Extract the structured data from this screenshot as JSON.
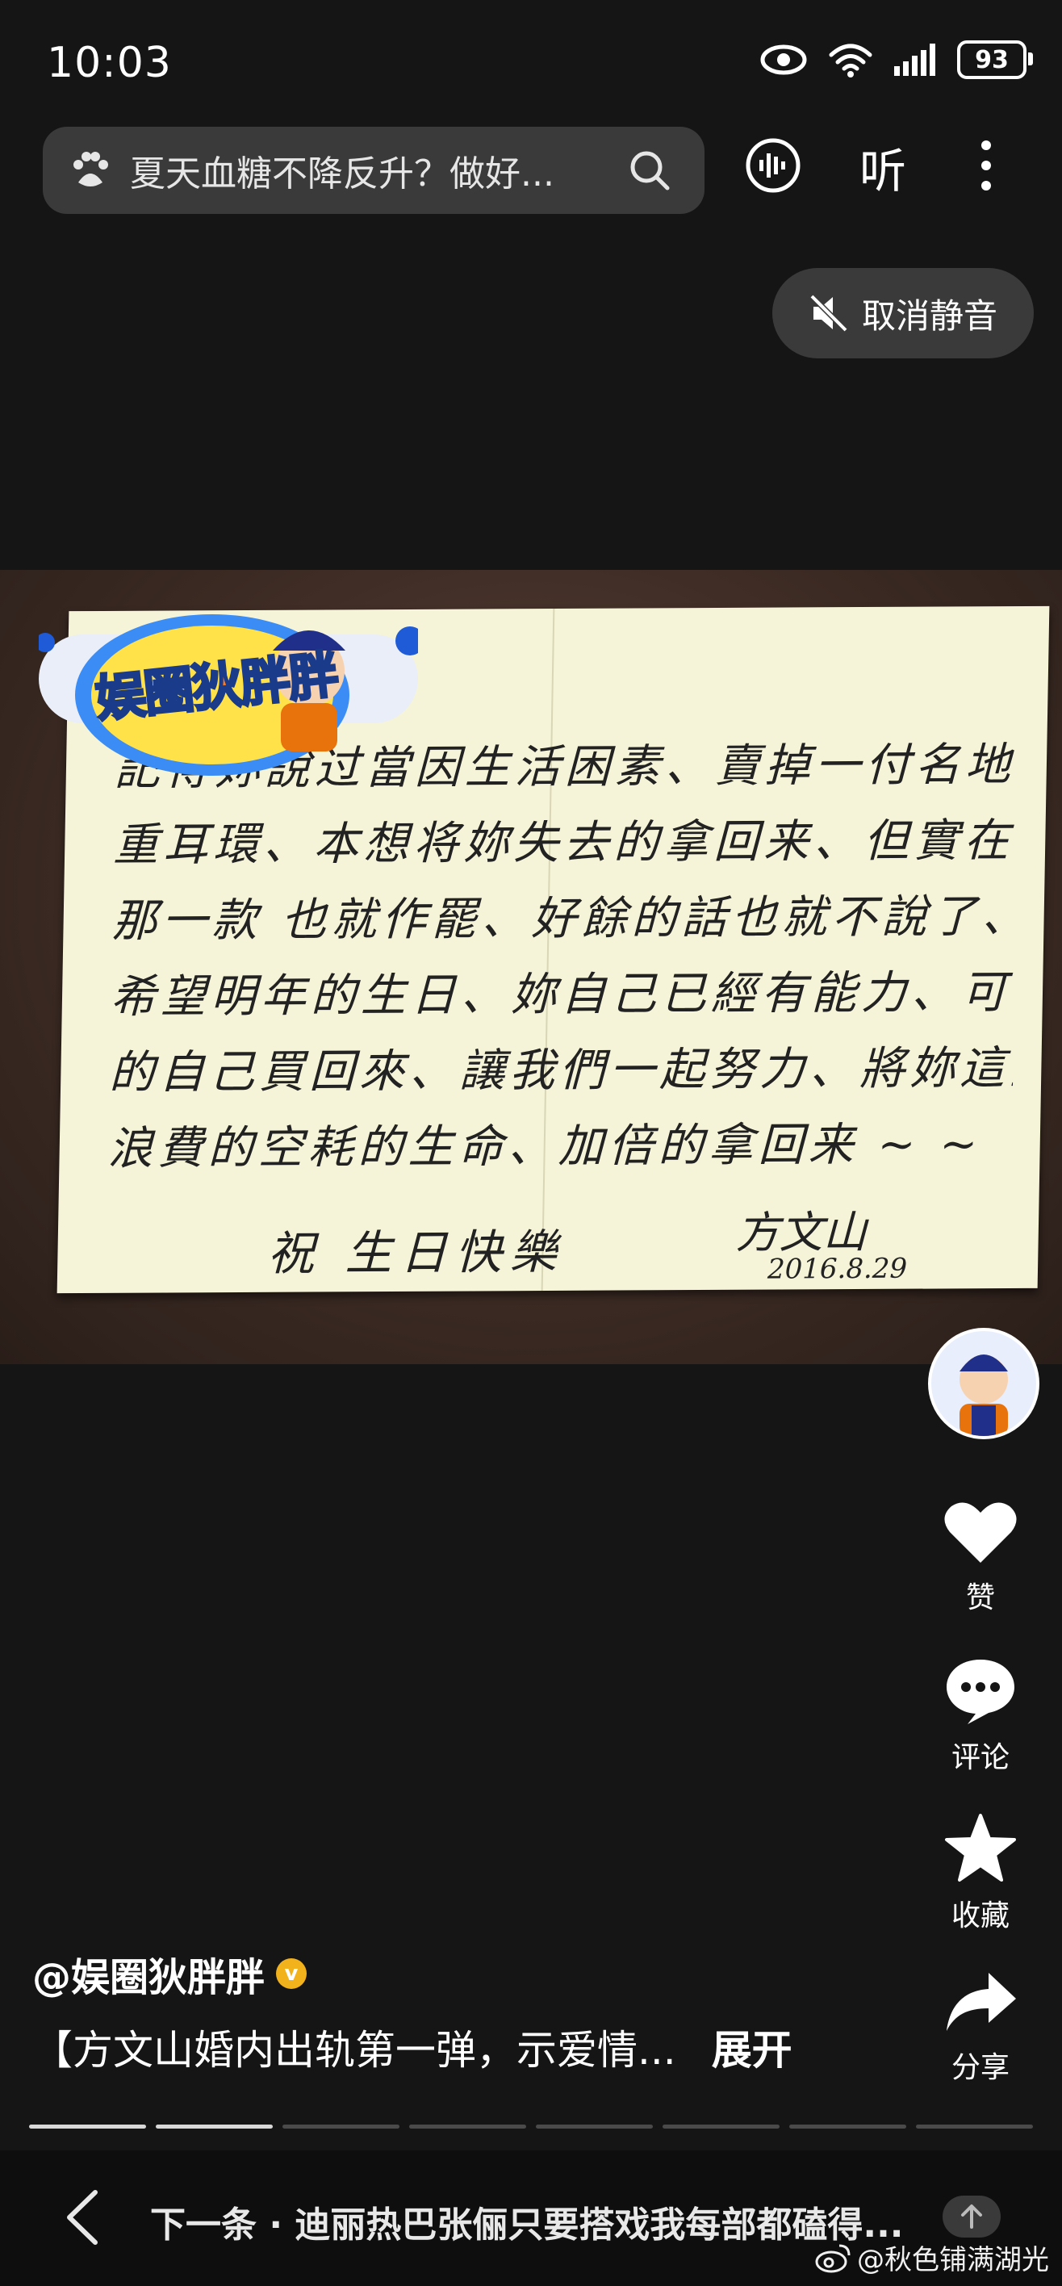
{
  "status_bar": {
    "time": "10:03",
    "battery": "93"
  },
  "search": {
    "query": "夏天血糖不降反升？做好..."
  },
  "toolbar": {
    "listen_label": "听"
  },
  "mute": {
    "label": "取消静音"
  },
  "letter": {
    "lines": [
      "記得妳說过當因生活困素、賣掉一付名地",
      "重耳環、本想将妳失去的拿回来、但實在不知",
      "那一款 也就作罷、好餘的話也就不說了、",
      "希望明年的生日、妳自己已經有能力、可以將失去",
      "的自己買回來、讓我們一起努力、將妳這些年",
      "浪費的空耗的生命、加倍的拿回来 ~ ~"
    ],
    "closing": "祝 生日快樂",
    "signature": "方文山",
    "date": "2016.8.29"
  },
  "logo": {
    "text": "娱圈狄胖胖"
  },
  "rail": {
    "like": "赞",
    "comment": "评论",
    "favorite": "收藏",
    "share": "分享"
  },
  "post": {
    "author": "@娱圈狄胖胖",
    "caption": "【方文山婚内出轨第一弹，示爱情...",
    "expand": "展开"
  },
  "progress": {
    "total_segments": 8,
    "viewed_segments": 2
  },
  "bottom_bar": {
    "next_label": "下一条 · 迪丽热巴张俪只要搭戏我每部都磕得...",
    "watermark": "@秋色铺满湖光"
  }
}
